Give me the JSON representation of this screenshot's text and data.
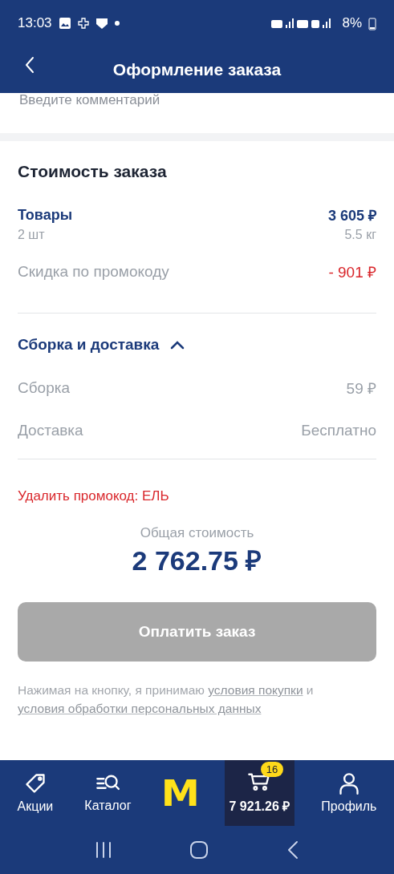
{
  "status_bar": {
    "time": "13:03",
    "battery": "8%"
  },
  "header": {
    "title": "Оформление заказа"
  },
  "comment": {
    "placeholder": "Введите комментарий"
  },
  "summary": {
    "title": "Стоимость заказа",
    "goods": {
      "label": "Товары",
      "value": "3 605 ₽",
      "count": "2 шт",
      "weight": "5.5 кг"
    },
    "discount": {
      "label": "Скидка по промокоду",
      "value": "- 901 ₽"
    },
    "assembly": {
      "title": "Сборка и доставка",
      "expanded": true,
      "rows": [
        {
          "label": "Сборка",
          "value": "59 ₽"
        },
        {
          "label": "Доставка",
          "value": "Бесплатно"
        }
      ]
    },
    "remove_promo": "Удалить промокод: ЕЛЬ",
    "total_label": "Общая стоимость",
    "total": "2 762.75 ₽",
    "pay_button": {
      "label": "Оплатить заказ",
      "disabled": true
    },
    "legal": {
      "text": "Нажимая на кнопку, я принимаю",
      "link1": "условия покупки",
      "and": "и",
      "link2": "условия обработки персональных данных"
    }
  },
  "bottom_nav": [
    {
      "kind": "tag",
      "label": "Акции",
      "selected": false
    },
    {
      "kind": "catalog",
      "label": "Каталог",
      "selected": false
    },
    {
      "kind": "logo",
      "label": "M",
      "selected": false
    },
    {
      "kind": "cart",
      "label": "7 921.26 ₽",
      "badge": "16",
      "selected": true
    },
    {
      "kind": "profile",
      "label": "Профиль",
      "selected": false
    }
  ]
}
